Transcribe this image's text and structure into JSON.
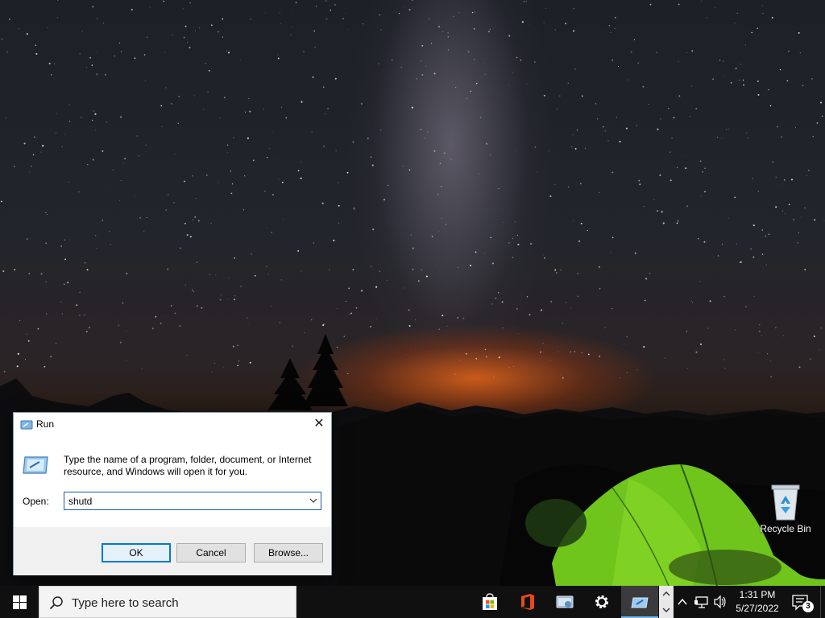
{
  "desktop": {
    "icons": [
      {
        "label": "Recycle Bin",
        "icon": "recycle-bin-icon"
      }
    ]
  },
  "run_dialog": {
    "title": "Run",
    "close_label": "✕",
    "description": "Type the name of a program, folder, document, or Internet resource, and Windows will open it for you.",
    "open_label": "Open:",
    "open_value": "shutd",
    "buttons": {
      "ok": "OK",
      "cancel": "Cancel",
      "browse": "Browse..."
    }
  },
  "taskbar": {
    "search_placeholder": "Type here to search",
    "pinned": [
      {
        "name": "microsoft-store-icon"
      },
      {
        "name": "office-icon"
      },
      {
        "name": "control-panel-icon"
      },
      {
        "name": "settings-icon"
      },
      {
        "name": "run-icon",
        "active": true
      }
    ],
    "clock": {
      "time": "1:31 PM",
      "date": "5/27/2022"
    },
    "notification_count": "3",
    "accent_color": "#0078d7"
  }
}
